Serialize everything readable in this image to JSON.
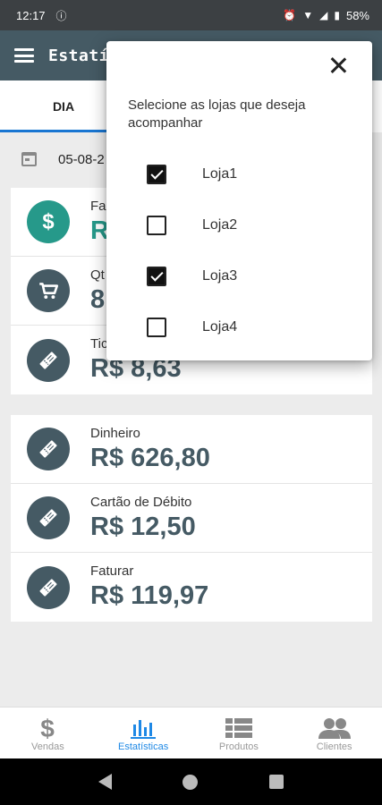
{
  "status_bar": {
    "time": "12:17",
    "battery": "58%",
    "icons": [
      "info-icon",
      "alarm-icon",
      "wifi-icon",
      "signal-icon",
      "battery-icon"
    ]
  },
  "app_bar": {
    "title": "Estatí"
  },
  "tabs": [
    {
      "label": "DIA",
      "active": true
    }
  ],
  "date": {
    "value": "05-08-2"
  },
  "summary_card": {
    "rows": [
      {
        "label": "Fa",
        "value": "R",
        "icon": "dollar-icon",
        "accent": "#26998a"
      },
      {
        "label": "Qt",
        "value": "8",
        "icon": "cart-icon"
      },
      {
        "label": "Tic",
        "value": "R$ 8,63",
        "icon": "ticket-icon"
      }
    ]
  },
  "payments_card": {
    "rows": [
      {
        "label": "Dinheiro",
        "value": "R$ 626,80",
        "icon": "ticket-icon"
      },
      {
        "label": "Cartão de Débito",
        "value": "R$ 12,50",
        "icon": "ticket-icon"
      },
      {
        "label": "Faturar",
        "value": "R$ 119,97",
        "icon": "ticket-icon"
      }
    ]
  },
  "bottom_nav": [
    {
      "label": "Vendas",
      "icon": "dollar-icon",
      "active": false
    },
    {
      "label": "Estatísticas",
      "icon": "bar-chart-icon",
      "active": true
    },
    {
      "label": "Produtos",
      "icon": "list-icon",
      "active": false
    },
    {
      "label": "Clientes",
      "icon": "people-icon",
      "active": false
    }
  ],
  "dialog": {
    "message": "Selecione as lojas que deseja acompanhar",
    "options": [
      {
        "label": "Loja1",
        "checked": true
      },
      {
        "label": "Loja2",
        "checked": false
      },
      {
        "label": "Loja3",
        "checked": true
      },
      {
        "label": "Loja4",
        "checked": false
      }
    ]
  },
  "colors": {
    "primary": "#455a64",
    "accent_teal": "#26998a",
    "active_blue": "#1e88e5"
  }
}
